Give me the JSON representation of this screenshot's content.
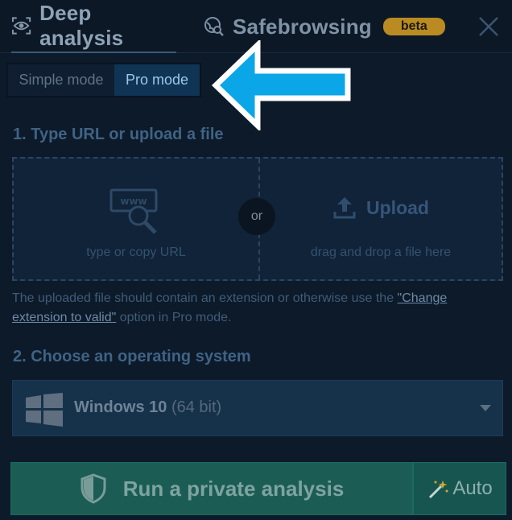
{
  "header": {
    "tabs": [
      {
        "label": "Deep analysis",
        "icon": "eye-scan-icon",
        "active": true
      },
      {
        "label": "Safebrowsing",
        "icon": "globe-search-icon",
        "active": false
      }
    ],
    "beta_badge": "beta",
    "close_icon": "close-icon"
  },
  "mode_toggle": {
    "simple_label": "Simple mode",
    "pro_label": "Pro mode",
    "selected": "Pro mode"
  },
  "step1": {
    "title": "1. Type URL or upload a file",
    "url_caption": "type or copy URL",
    "upload_label": "Upload",
    "upload_caption": "drag and drop a file here",
    "or_label": "or",
    "note_before": "The uploaded file should contain an extension or otherwise use the ",
    "note_link": "\"Change extension to valid\"",
    "note_after": " option in Pro mode."
  },
  "step2": {
    "title": "2. Choose an operating system",
    "os_name": "Windows 10",
    "os_arch": "(64 bit)"
  },
  "actions": {
    "run_label": "Run a private analysis",
    "auto_label": "Auto"
  },
  "colors": {
    "background": "#0d1a2a",
    "accent_blue": "#0aa6e8",
    "pro_active": "#103454",
    "run_green": "#1b5d55",
    "beta_gold": "#b98b22"
  }
}
